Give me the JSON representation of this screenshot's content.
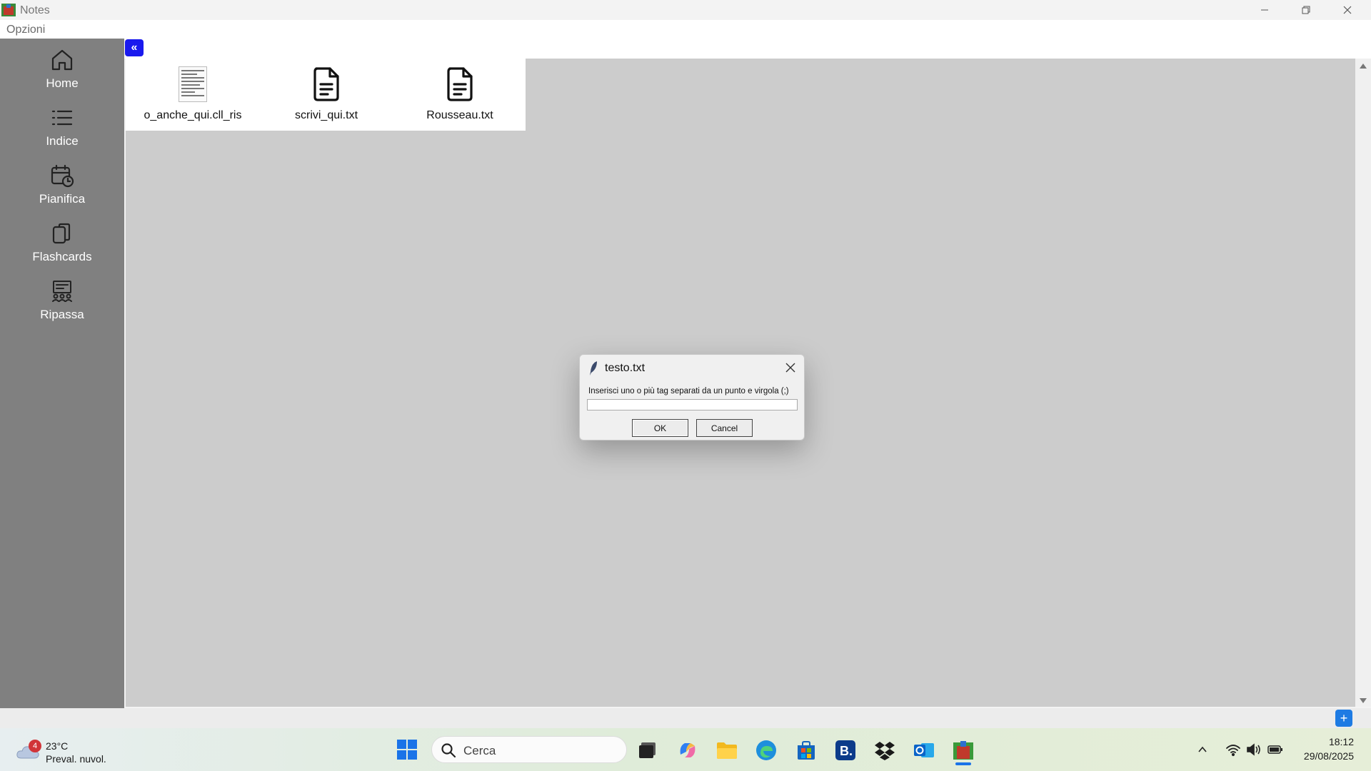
{
  "window": {
    "title": "Notes",
    "menu": [
      "Opzioni"
    ]
  },
  "sidebar": {
    "items": [
      {
        "label": "Home",
        "icon": "home-icon"
      },
      {
        "label": "Indice",
        "icon": "list-icon"
      },
      {
        "label": "Pianifica",
        "icon": "calendar-clock-icon"
      },
      {
        "label": "Flashcards",
        "icon": "cards-icon"
      },
      {
        "label": "Ripassa",
        "icon": "review-icon"
      }
    ]
  },
  "toolbar": {
    "collapse_label": "«",
    "add_label": "+"
  },
  "files": [
    {
      "name": "o_anche_qui.cll_ris",
      "icon": "document-thumbnail-icon"
    },
    {
      "name": "scrivi_qui.txt",
      "icon": "text-file-icon"
    },
    {
      "name": "Rousseau.txt",
      "icon": "text-file-icon"
    }
  ],
  "dialog": {
    "title": "testo.txt",
    "prompt": "Inserisci uno o più tag separati da un punto e virgola (;)",
    "input_value": "",
    "ok_label": "OK",
    "cancel_label": "Cancel"
  },
  "taskbar": {
    "weather": {
      "badge": "4",
      "temperature": "23°C",
      "description": "Preval. nuvol."
    },
    "search_placeholder": "Cerca",
    "apps": [
      "task-view-icon",
      "copilot-icon",
      "file-explorer-icon",
      "edge-icon",
      "store-icon",
      "booking-icon",
      "dropbox-icon",
      "outlook-icon",
      "notes-app-icon"
    ],
    "clock": {
      "time": "18:12",
      "date": "29/08/2025"
    }
  },
  "colors": {
    "sidebar": "#808080",
    "content": "#cccccc",
    "collapse_button": "#1a1aee",
    "add_button": "#1e7be3"
  }
}
